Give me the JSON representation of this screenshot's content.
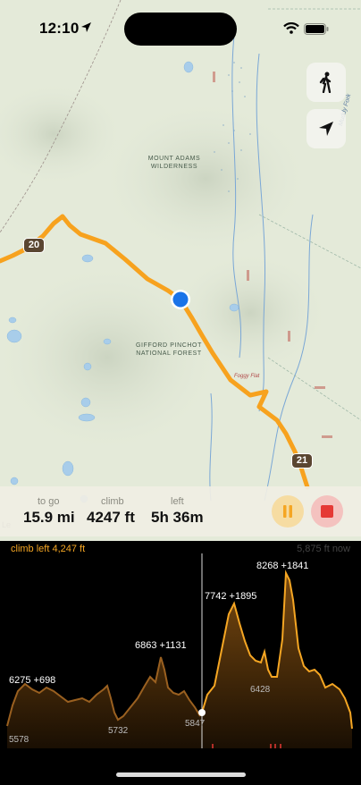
{
  "status_bar": {
    "time": "12:10",
    "icons": [
      "location-arrow-icon",
      "wifi-icon",
      "battery-icon"
    ]
  },
  "map": {
    "labels": {
      "wilderness": "MOUNT ADAMS\nWILDERNESS",
      "forest": "GIFFORD PINCHOT\nNATIONAL FOREST",
      "creek": "Muddy Fork",
      "flat": "Foggy Flat"
    },
    "trail_markers": [
      "20",
      "21"
    ],
    "buttons": [
      "hiker-icon",
      "navigation-arrow-icon"
    ],
    "legal": "Le",
    "colors": {
      "trail": "#f7a21e",
      "location": "#1a73e8",
      "terrain": "#e4ead9",
      "water": "#a8cdea"
    }
  },
  "stats": {
    "to_go_label": "to go",
    "to_go_value": "15.9 mi",
    "climb_label": "climb",
    "climb_value": "4247 ft",
    "left_label": "left",
    "left_value": "5h 36m"
  },
  "controls": {
    "pause_icon": "pause-icon",
    "stop_icon": "stop-icon",
    "pause_color": "#f5a623",
    "stop_color": "#e53935"
  },
  "elevation": {
    "climb_left": "climb left 4,247 ft",
    "now": "5,875 ft now",
    "peaks": [
      {
        "label": "6275 +698"
      },
      {
        "label": "6863 +1131"
      },
      {
        "label": "7742 +1895"
      },
      {
        "label": "8268 +1841"
      }
    ],
    "lows": [
      "5578",
      "5732",
      "5847",
      "6428"
    ],
    "colors": {
      "line": "#f5a623",
      "fill_top": "#7a4a10",
      "fill_bottom": "#1a0f03"
    }
  }
}
